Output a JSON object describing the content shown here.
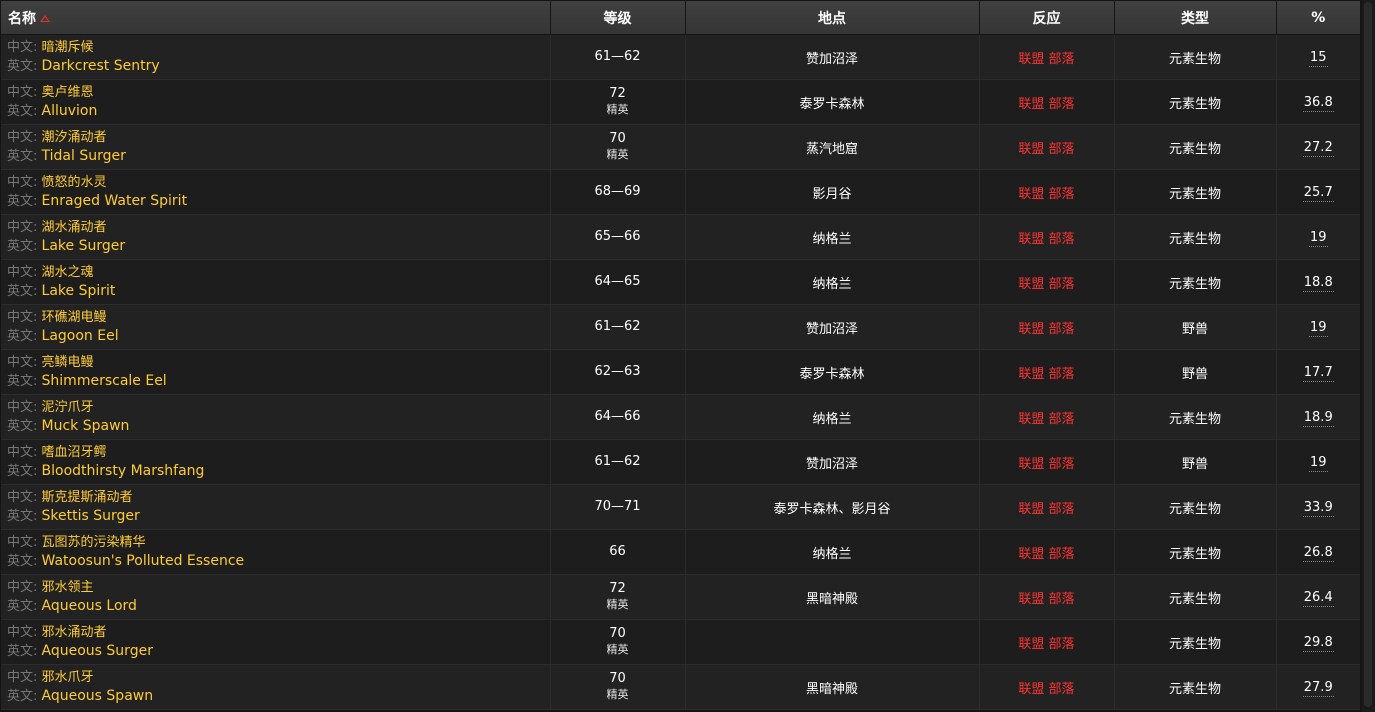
{
  "columns": {
    "name": "名称",
    "level": "等级",
    "location": "地点",
    "reaction": "反应",
    "type": "类型",
    "percent": "%"
  },
  "labels": {
    "cn_prefix": "中文:",
    "en_prefix": "英文:"
  },
  "colors": {
    "name_text": "#ffcc33",
    "reaction_text": "#ff3333",
    "prefix_text": "#777777",
    "sort_arrow": "#e03030"
  },
  "icons": {
    "sort": "sort-ascending-icon"
  },
  "rows": [
    {
      "cn": "暗潮斥候",
      "en": "Darkcrest Sentry",
      "level": "61—62",
      "level_tag": "",
      "location": "赞加沼泽",
      "reaction": "联盟 部落",
      "type": "元素生物",
      "percent": "15"
    },
    {
      "cn": "奥卢维恩",
      "en": "Alluvion",
      "level": "72",
      "level_tag": "精英",
      "location": "泰罗卡森林",
      "reaction": "联盟 部落",
      "type": "元素生物",
      "percent": "36.8"
    },
    {
      "cn": "潮汐涌动者",
      "en": "Tidal Surger",
      "level": "70",
      "level_tag": "精英",
      "location": "蒸汽地窟",
      "reaction": "联盟 部落",
      "type": "元素生物",
      "percent": "27.2"
    },
    {
      "cn": "愤怒的水灵",
      "en": "Enraged Water Spirit",
      "level": "68—69",
      "level_tag": "",
      "location": "影月谷",
      "reaction": "联盟 部落",
      "type": "元素生物",
      "percent": "25.7"
    },
    {
      "cn": "湖水涌动者",
      "en": "Lake Surger",
      "level": "65—66",
      "level_tag": "",
      "location": "纳格兰",
      "reaction": "联盟 部落",
      "type": "元素生物",
      "percent": "19"
    },
    {
      "cn": "湖水之魂",
      "en": "Lake Spirit",
      "level": "64—65",
      "level_tag": "",
      "location": "纳格兰",
      "reaction": "联盟 部落",
      "type": "元素生物",
      "percent": "18.8"
    },
    {
      "cn": "环礁湖电鳗",
      "en": "Lagoon Eel",
      "level": "61—62",
      "level_tag": "",
      "location": "赞加沼泽",
      "reaction": "联盟 部落",
      "type": "野兽",
      "percent": "19"
    },
    {
      "cn": "亮鳞电鳗",
      "en": "Shimmerscale Eel",
      "level": "62—63",
      "level_tag": "",
      "location": "泰罗卡森林",
      "reaction": "联盟 部落",
      "type": "野兽",
      "percent": "17.7"
    },
    {
      "cn": "泥泞爪牙",
      "en": "Muck Spawn",
      "level": "64—66",
      "level_tag": "",
      "location": "纳格兰",
      "reaction": "联盟 部落",
      "type": "元素生物",
      "percent": "18.9"
    },
    {
      "cn": "嗜血沼牙鳄",
      "en": "Bloodthirsty Marshfang",
      "level": "61—62",
      "level_tag": "",
      "location": "赞加沼泽",
      "reaction": "联盟 部落",
      "type": "野兽",
      "percent": "19"
    },
    {
      "cn": "斯克提斯涌动者",
      "en": "Skettis Surger",
      "level": "70—71",
      "level_tag": "",
      "location": "泰罗卡森林、影月谷",
      "reaction": "联盟 部落",
      "type": "元素生物",
      "percent": "33.9"
    },
    {
      "cn": "瓦图苏的污染精华",
      "en": "Watoosun's Polluted Essence",
      "level": "66",
      "level_tag": "",
      "location": "纳格兰",
      "reaction": "联盟 部落",
      "type": "元素生物",
      "percent": "26.8"
    },
    {
      "cn": "邪水领主",
      "en": "Aqueous Lord",
      "level": "72",
      "level_tag": "精英",
      "location": "黑暗神殿",
      "reaction": "联盟 部落",
      "type": "元素生物",
      "percent": "26.4"
    },
    {
      "cn": "邪水涌动者",
      "en": "Aqueous Surger",
      "level": "70",
      "level_tag": "精英",
      "location": "",
      "reaction": "联盟 部落",
      "type": "元素生物",
      "percent": "29.8"
    },
    {
      "cn": "邪水爪牙",
      "en": "Aqueous Spawn",
      "level": "70",
      "level_tag": "精英",
      "location": "黑暗神殿",
      "reaction": "联盟 部落",
      "type": "元素生物",
      "percent": "27.9"
    }
  ]
}
